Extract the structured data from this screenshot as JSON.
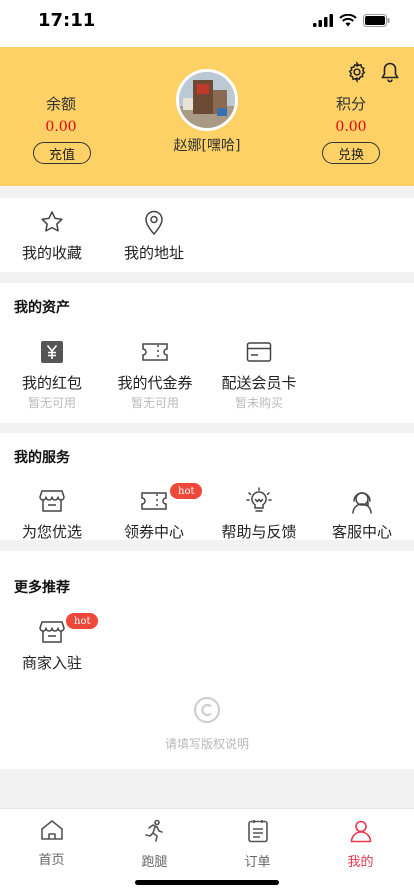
{
  "status": {
    "time": "17:11"
  },
  "header": {
    "balance_label": "余额",
    "balance_value": "0.00",
    "recharge_label": "充值",
    "points_label": "积分",
    "points_value": "0.00",
    "exchange_label": "兑换",
    "username": "赵娜[嘿哈]",
    "accent": "#fdd166"
  },
  "quick": {
    "items": [
      {
        "label": "我的收藏",
        "icon": "star-icon"
      },
      {
        "label": "我的地址",
        "icon": "location-pin-icon"
      }
    ]
  },
  "assets": {
    "title": "我的资产",
    "items": [
      {
        "label": "我的红包",
        "sub": "暂无可用",
        "icon": "yuan-icon"
      },
      {
        "label": "我的代金券",
        "sub": "暂无可用",
        "icon": "ticket-icon"
      },
      {
        "label": "配送会员卡",
        "sub": "暂未购买",
        "icon": "card-icon"
      }
    ]
  },
  "services": {
    "title": "我的服务",
    "items": [
      {
        "label": "为您优选",
        "icon": "shop-icon"
      },
      {
        "label": "领券中心",
        "icon": "ticket-icon",
        "badge": "hot"
      },
      {
        "label": "帮助与反馈",
        "icon": "lightbulb-icon"
      },
      {
        "label": "客服中心",
        "icon": "headset-icon"
      }
    ]
  },
  "more": {
    "title": "更多推荐",
    "items": [
      {
        "label": "商家入驻",
        "icon": "shop-icon",
        "badge": "hot"
      }
    ]
  },
  "footer": {
    "copyright": "请填写版权说明"
  },
  "tabs": [
    {
      "label": "首页",
      "icon": "home-icon"
    },
    {
      "label": "跑腿",
      "icon": "runner-icon"
    },
    {
      "label": "订单",
      "icon": "order-list-icon"
    },
    {
      "label": "我的",
      "icon": "user-icon",
      "active": true
    }
  ],
  "colors": {
    "active_tab": "#e8384f",
    "price": "#e60012",
    "hot_badge": "#f0473b"
  }
}
